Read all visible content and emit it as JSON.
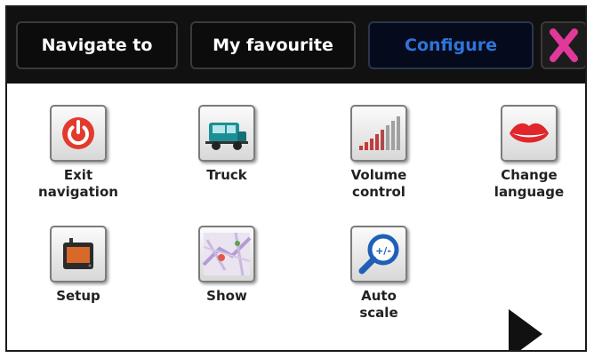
{
  "tabs": [
    {
      "label": "Navigate to",
      "active": false
    },
    {
      "label": "My favourite",
      "active": false
    },
    {
      "label": "Configure",
      "active": true
    }
  ],
  "close": {
    "icon": "close-x-icon",
    "color": "#e0399a"
  },
  "menu_items": [
    {
      "label": "Exit\nnavigation",
      "icon": "power-icon"
    },
    {
      "label": "Truck",
      "icon": "truck-icon"
    },
    {
      "label": "Volume\ncontrol",
      "icon": "volume-icon"
    },
    {
      "label": "Change\nlanguage",
      "icon": "lips-icon"
    },
    {
      "label": "Setup",
      "icon": "device-icon"
    },
    {
      "label": "Show",
      "icon": "map-icon"
    },
    {
      "label": "Auto\nscale",
      "icon": "magnifier-icon"
    }
  ],
  "next_page": {
    "icon": "next-arrow-icon"
  },
  "colors": {
    "accent": "#2f74d8",
    "tab_bar": "#111111",
    "close": "#e0399a"
  }
}
